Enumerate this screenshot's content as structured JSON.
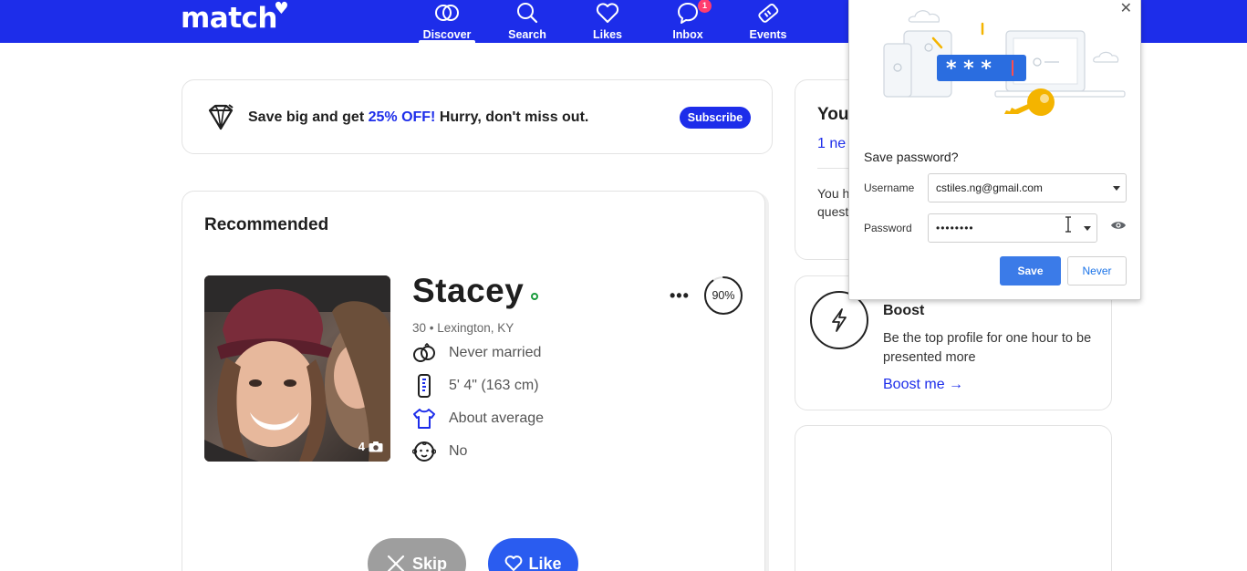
{
  "header": {
    "logo": "match",
    "nav": [
      {
        "label": "Discover",
        "icon": "discover-icon",
        "active": true
      },
      {
        "label": "Search",
        "icon": "search-icon"
      },
      {
        "label": "Likes",
        "icon": "heart-icon"
      },
      {
        "label": "Inbox",
        "icon": "chat-bubble-icon",
        "badge": "1"
      },
      {
        "label": "Events",
        "icon": "ticket-icon"
      }
    ]
  },
  "promo": {
    "text_before": "Save big and get ",
    "text_accent": "25% OFF!",
    "text_after": " Hurry, don't miss out.",
    "button": "Subscribe",
    "icon": "diamond-tag-icon"
  },
  "recommended": {
    "title": "Recommended",
    "profile": {
      "name": "Stacey",
      "meta": "30 • Lexington, KY",
      "photo_count": "4",
      "match_percent": "90%",
      "match_fraction": 0.9,
      "attributes": [
        {
          "icon": "rings-icon",
          "text": "Never married"
        },
        {
          "icon": "ruler-icon",
          "text": "5' 4\" (163 cm)"
        },
        {
          "icon": "shirt-icon",
          "text": "About average"
        },
        {
          "icon": "baby-icon",
          "text": "No"
        }
      ]
    },
    "skip_label": "Skip",
    "like_label": "Like"
  },
  "right": {
    "card1_title": "You",
    "card1_link": "1 ne",
    "card1_text": "You h quest",
    "boost": {
      "title": "Boost",
      "description": "Be the top profile for one hour to be presented more",
      "link": "Boost me →"
    }
  },
  "password_popup": {
    "title": "Save password?",
    "username_label": "Username",
    "username_value": "cstiles.ng@gmail.com",
    "password_label": "Password",
    "password_value": "••••••••",
    "save_label": "Save",
    "never_label": "Never",
    "illustration_mask": "* * *"
  },
  "colors": {
    "brand": "#1d2dea",
    "online": "#1a9b3c",
    "badge": "#ff3d6e",
    "chrome_save": "#3b7be8"
  }
}
